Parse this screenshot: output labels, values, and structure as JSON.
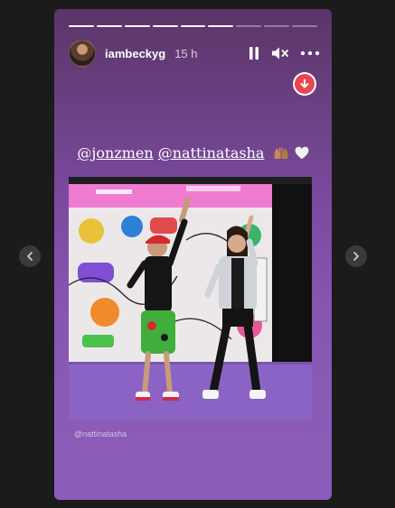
{
  "story": {
    "username": "iambeckyg",
    "timestamp": "15 h",
    "progress_total": 9,
    "progress_completed": 6,
    "caption_mentions": [
      "@jonzmen",
      "@nattinatasha"
    ],
    "caption_emojis": [
      "raising-hands-emoji",
      "white-heart-emoji"
    ],
    "photo_credit": "@nattinatasha"
  },
  "controls": {
    "pause_icon": "pause-icon",
    "mute_icon": "speaker-muted-icon",
    "more_icon": "more-options-icon",
    "save_icon": "download-arrow-icon",
    "prev_icon": "chevron-left-icon",
    "next_icon": "chevron-right-icon"
  },
  "colors": {
    "page_background": "#1b1b1b",
    "story_gradient_top": "#5a3568",
    "story_gradient_bottom": "#8d5cba",
    "save_badge": "#e8474f"
  }
}
